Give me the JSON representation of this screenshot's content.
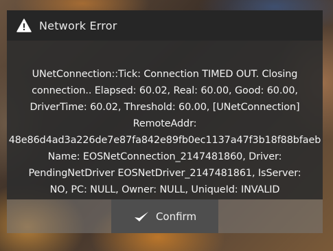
{
  "dialog": {
    "title": "Network Error",
    "title_icon": "warning-icon",
    "message": "UNetConnection::Tick: Connection TIMED OUT. Closing\nconnection.. Elapsed: 60.02, Real: 60.00, Good: 60.00,\nDriverTime: 60.02, Threshold: 60.00, [UNetConnection]\nRemoteAddr:\n48e86d4ad3a226de7e87fa842e89fb0ec1137a47f3b18f88bfaeb\nName: EOSNetConnection_2147481860, Driver:\nPendingNetDriver EOSNetDriver_2147481861, IsServer:\nNO, PC: NULL, Owner: NULL, UniqueId: INVALID",
    "confirm_label": "Confirm",
    "confirm_icon": "checkmark-icon"
  },
  "colors": {
    "title_bar": "#262626",
    "body": "#2e2e2e",
    "footer": "#787878",
    "button": "#4e4e4e",
    "text": "#f4f4f4"
  }
}
